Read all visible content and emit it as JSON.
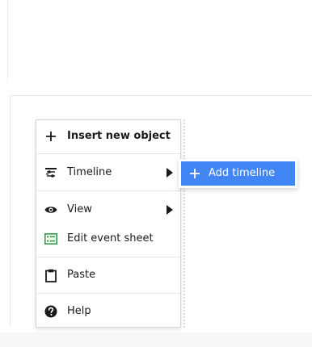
{
  "colors": {
    "accent": "#4285f4",
    "event_sheet_icon": "#2e9e44",
    "text": "#1a1a1a"
  },
  "context_menu": {
    "items": [
      {
        "label": "Insert new object",
        "icon": "plus-icon",
        "bold": true
      },
      {
        "label": "Timeline",
        "icon": "timeline-icon",
        "has_submenu": true
      },
      {
        "label": "View",
        "icon": "eye-icon",
        "has_submenu": true
      },
      {
        "label": "Edit event sheet",
        "icon": "event-sheet-icon"
      },
      {
        "label": "Paste",
        "icon": "clipboard-icon"
      },
      {
        "label": "Help",
        "icon": "help-icon"
      }
    ]
  },
  "submenu": {
    "items": [
      {
        "label": "Add timeline",
        "icon": "plus-icon",
        "highlighted": true
      }
    ]
  }
}
